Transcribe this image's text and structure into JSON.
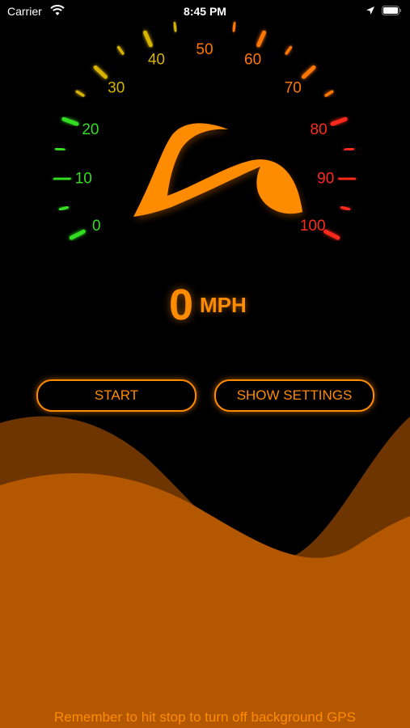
{
  "status_bar": {
    "carrier": "Carrier",
    "time": "8:45 PM",
    "icons": [
      "wifi-icon",
      "location-arrow-icon",
      "battery-icon"
    ]
  },
  "gauge": {
    "labels": [
      "0",
      "10",
      "20",
      "30",
      "40",
      "50",
      "60",
      "70",
      "80",
      "90",
      "100"
    ],
    "min": 0,
    "max": 100,
    "needle_value": 0,
    "colors": {
      "low": "#33dd22",
      "mid": "#d6b300",
      "high": "#ff7700",
      "max": "#ff2a1a",
      "needle": "#ff8b00"
    }
  },
  "speed": {
    "value": "0",
    "unit": "MPH"
  },
  "buttons": {
    "start": "START",
    "settings": "SHOW SETTINGS"
  },
  "footer": {
    "note": "Remember to hit stop to turn off background GPS"
  },
  "theme": {
    "accent": "#ff8b00",
    "wave_back": "#6e3500",
    "wave_front": "#b35700",
    "background": "#000000"
  }
}
